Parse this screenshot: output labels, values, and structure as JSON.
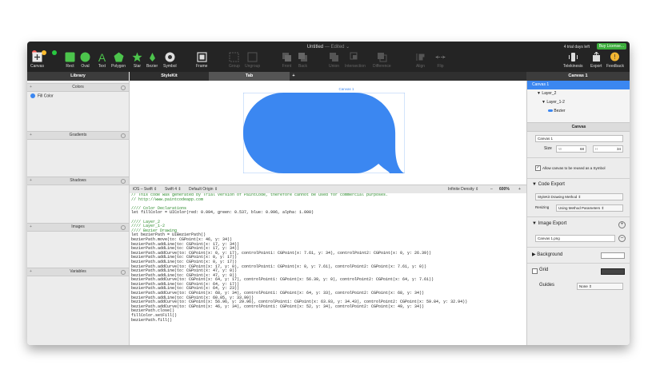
{
  "window": {
    "title": "Untitled",
    "edited": "— Edited ⌄",
    "trial_text": "4 trial days left",
    "buy_label": "Buy License..."
  },
  "toolbar": {
    "canvas": "Canvas",
    "rect": "Rect",
    "oval": "Oval",
    "text": "Text",
    "polygon": "Polygon",
    "star": "Star",
    "bezier": "Bezier",
    "symbol": "Symbol",
    "frame": "Frame",
    "group": "Group",
    "ungroup": "Ungroup",
    "front": "Front",
    "back": "Back",
    "union": "Union",
    "intersection": "Intersection",
    "difference": "Difference",
    "align": "Align",
    "flip": "Flip",
    "telekinesis": "Telekinesis",
    "export": "Export",
    "feedback": "Feedback"
  },
  "headers": {
    "library": "Library",
    "stylekit": "StyleKit",
    "tab": "Tab",
    "add": "+",
    "canvas_select": "Canvas 1"
  },
  "library": {
    "colors": "Colors",
    "fill_color": "Fill Color",
    "gradients": "Gradients",
    "shadows": "Shadows",
    "images": "Images",
    "variables": "Variables",
    "plus": "+"
  },
  "canvas": {
    "label": "Canvas 1",
    "shape_color": "#3b87f1"
  },
  "codebar": {
    "platform": "iOS – Swift ⇕",
    "version": "Swift 4 ⇕",
    "origin": "Default Origin ⇕",
    "density": "Infinite Density ⇕",
    "minus": "–",
    "zoom": "600%",
    "plus": "+"
  },
  "code_lines": [
    "// This code was generated by Trial version of PaintCode, therefore cannot be used for commercial purposes.",
    "// http://www.paintcodeapp.com",
    "",
    "//// Color Declarations",
    "let fillColor = UIColor(red: 0.094, green: 0.537, blue: 0.996, alpha: 1.000)",
    "",
    "//// Layer_2",
    "//// Layer_1-2",
    "//// Bezier Drawing",
    "let bezierPath = UIBezierPath()",
    "bezierPath.move(to: CGPoint(x: 46, y: 34))",
    "bezierPath.addLine(to: CGPoint(x: 17, y: 34))",
    "bezierPath.addLine(to: CGPoint(x: 17, y: 34))",
    "bezierPath.addCurve(to: CGPoint(x: 0, y: 17), controlPoint1: CGPoint(x: 7.61, y: 34), controlPoint2: CGPoint(x: 0, y: 26.39))",
    "bezierPath.addLine(to: CGPoint(x: 0, y: 17))",
    "bezierPath.addLine(to: CGPoint(x: 0, y: 17))",
    "bezierPath.addCurve(to: CGPoint(x: 17, y: 0), controlPoint1: CGPoint(x: 0, y: 7.61), controlPoint2: CGPoint(x: 7.61, y: 0))",
    "bezierPath.addLine(to: CGPoint(x: 47, y: 0))",
    "bezierPath.addLine(to: CGPoint(x: 47, y: 0))",
    "bezierPath.addCurve(to: CGPoint(x: 64, y: 17), controlPoint1: CGPoint(x: 56.39, y: 0), controlPoint2: CGPoint(x: 64, y: 7.61))",
    "bezierPath.addLine(to: CGPoint(x: 64, y: 17))",
    "bezierPath.addLine(to: CGPoint(x: 64, y: 23))",
    "bezierPath.addCurve(to: CGPoint(x: 68, y: 34), controlPoint1: CGPoint(x: 64, y: 33), controlPoint2: CGPoint(x: 68, y: 34))",
    "bezierPath.addLine(to: CGPoint(x: 60.05, y: 33.99))",
    "bezierPath.addCurve(to: CGPoint(x: 56.96, y: 29.96), controlPoint1: CGPoint(x: 63.93, y: 34.43), controlPoint2: CGPoint(x: 59.84, y: 32.94))",
    "bezierPath.addCurve(to: CGPoint(x: 46, y: 34), controlPoint1: CGPoint(x: 52, y: 34), controlPoint2: CGPoint(x: 49, y: 34))",
    "bezierPath.close()",
    "fillColor.setFill()",
    "bezierPath.fill()"
  ],
  "inspector": {
    "tree": [
      "Canvas 1",
      "Layer_2",
      "Layer_1-2",
      "Bezier"
    ],
    "canvas_header": "Canvas",
    "canvas_name": "Canvas 1",
    "size_label": "Size",
    "w_label": "W",
    "w_value": "68",
    "h_label": "H",
    "h_value": "34",
    "reuse_label": "Allow canvas to be reused as a Symbol",
    "code_export": "Code Export",
    "method": "StyleKit Drawing Method ⇕",
    "resizing_label": "Resizing",
    "resizing_value": "Using Method Parameters ⇕",
    "image_export": "Image Export",
    "image_file": "Canvas 1.png",
    "background": "Background",
    "grid": "Grid",
    "guides": "Guides",
    "guides_value": "None ⇕"
  }
}
